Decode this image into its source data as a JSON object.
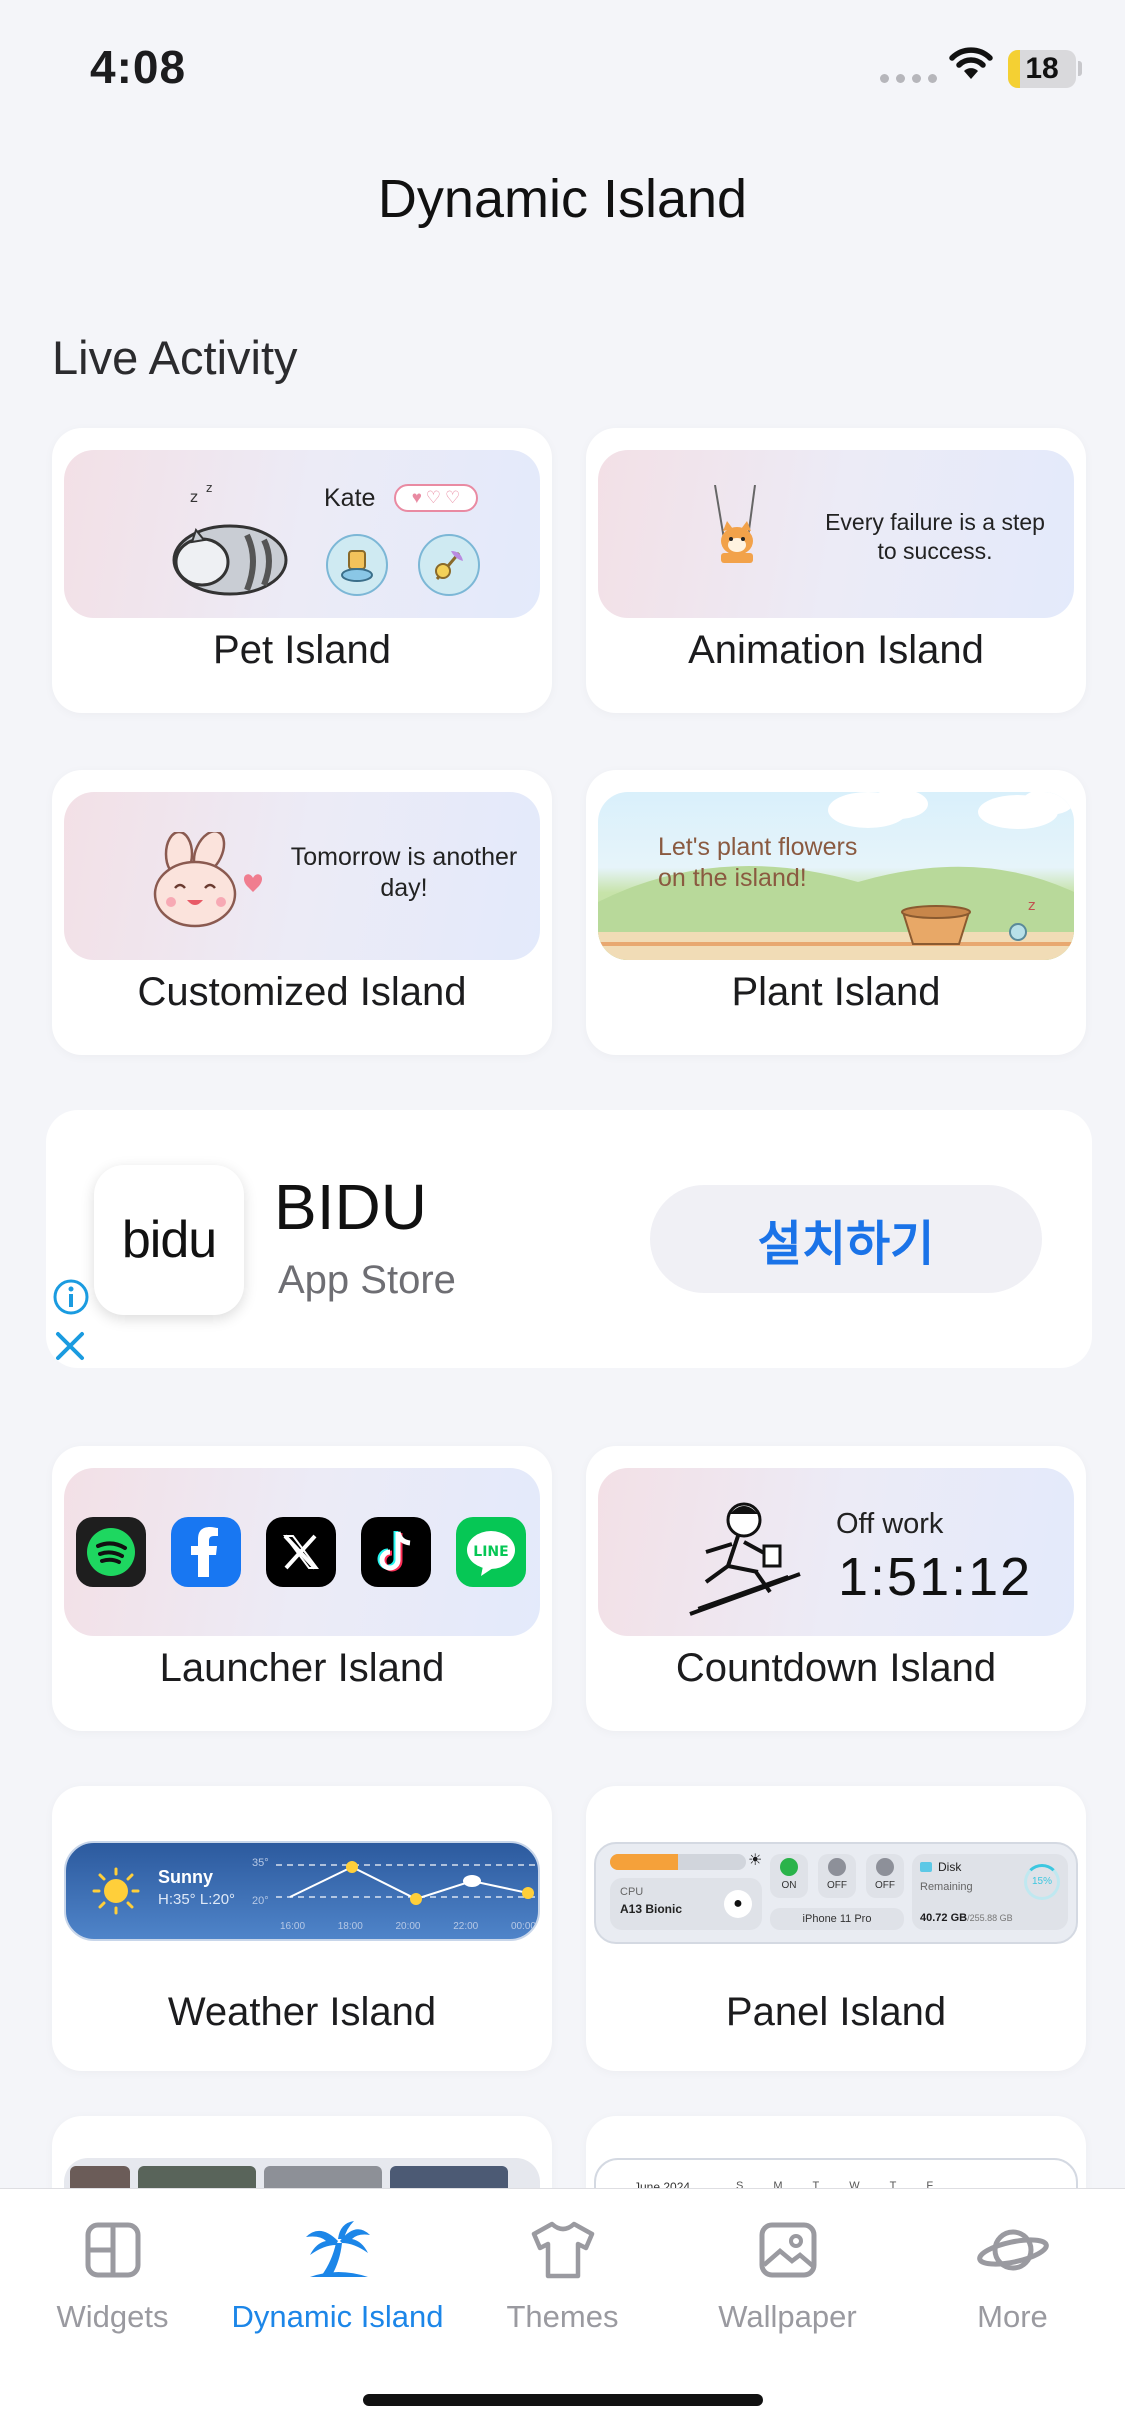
{
  "status": {
    "time": "4:08",
    "battery": "18",
    "battery_level": 0.18
  },
  "header": {
    "title": "Dynamic Island"
  },
  "section": {
    "title": "Live Activity"
  },
  "cards": {
    "pet": {
      "label": "Pet Island",
      "name": "Kate"
    },
    "animation": {
      "label": "Animation Island",
      "quote": "Every failure is a step to success."
    },
    "customized": {
      "label": "Customized Island",
      "quote": "Tomorrow is another day!"
    },
    "plant": {
      "label": "Plant Island",
      "text": "Let's plant flowers on the island!"
    },
    "launcher": {
      "label": "Launcher Island",
      "apps": [
        "spotify-icon",
        "facebook-icon",
        "x-icon",
        "tiktok-icon",
        "line-icon"
      ]
    },
    "countdown": {
      "label": "Countdown Island",
      "caption": "Off work",
      "time": "1:51:12"
    },
    "weather": {
      "label": "Weather Island",
      "condition": "Sunny",
      "range": "H:35° L:20°",
      "scale_high": "35°",
      "scale_low": "20°",
      "hours": [
        "16:00",
        "18:00",
        "20:00",
        "22:00",
        "00:00"
      ]
    },
    "panel": {
      "label": "Panel Island",
      "cpu_label": "CPU",
      "cpu_name": "A13 Bionic",
      "toggles": [
        "ON",
        "OFF",
        "OFF"
      ],
      "device": "iPhone 11 Pro",
      "disk_label": "Disk",
      "disk_remaining": "Remaining",
      "disk_value": "40.72 GB",
      "disk_total": "/255.88 GB",
      "disk_percent": "15%"
    },
    "partial_right": {
      "month": "June 2024",
      "weekdays": [
        "S",
        "M",
        "T",
        "W",
        "T",
        "F"
      ]
    }
  },
  "ad": {
    "logo": "bidu",
    "name": "BIDU",
    "store": "App Store",
    "cta": "설치하기"
  },
  "tabbar": {
    "items": [
      {
        "label": "Widgets",
        "icon": "widgets-icon"
      },
      {
        "label": "Dynamic Island",
        "icon": "palm-tree-icon"
      },
      {
        "label": "Themes",
        "icon": "tshirt-icon"
      },
      {
        "label": "Wallpaper",
        "icon": "image-icon"
      },
      {
        "label": "More",
        "icon": "planet-icon"
      }
    ],
    "active": "Dynamic Island"
  },
  "colors": {
    "accent": "#1c86e8",
    "background": "#f4f5f9",
    "card": "#ffffff",
    "ad_cta": "#1a73e8"
  }
}
